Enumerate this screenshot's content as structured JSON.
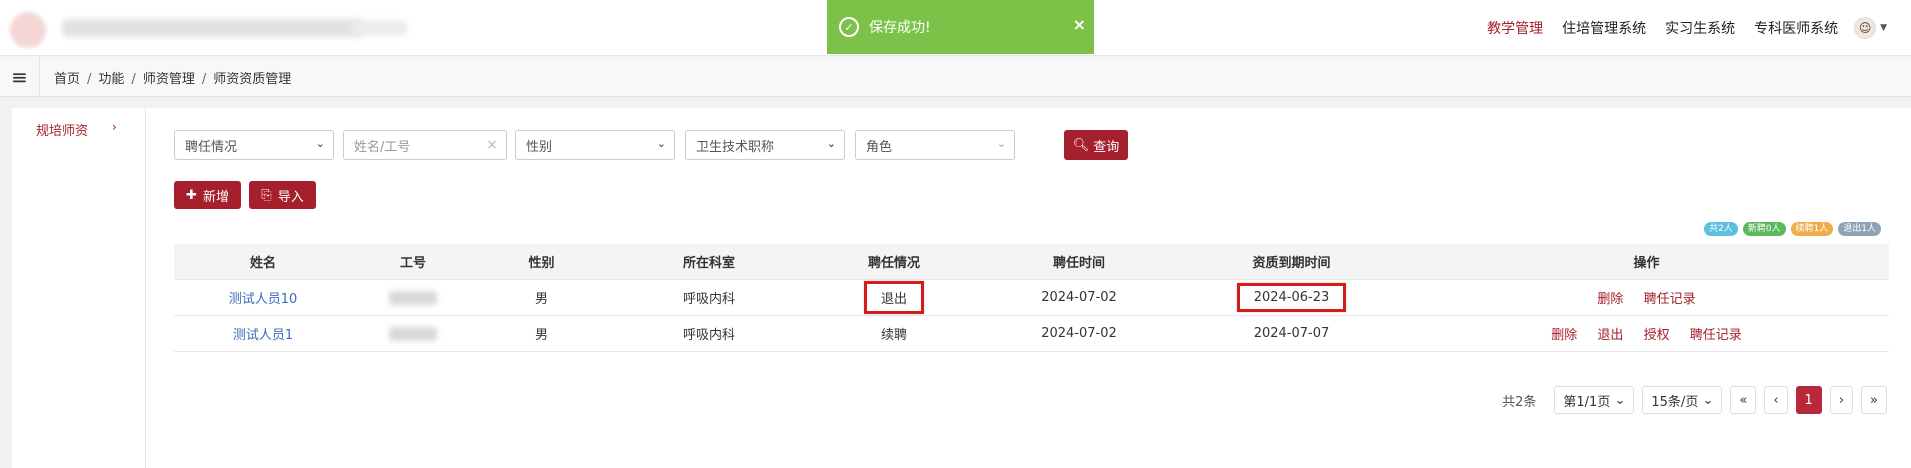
{
  "toast": {
    "message": "保存成功!",
    "close": "×"
  },
  "topnav": [
    {
      "label": "教学管理",
      "active": true
    },
    {
      "label": "住培管理系统",
      "active": false
    },
    {
      "label": "实习生系统",
      "active": false
    },
    {
      "label": "专科医师系统",
      "active": false
    }
  ],
  "breadcrumb": [
    "首页",
    "功能",
    "师资管理",
    "师资资质管理"
  ],
  "sidebar": {
    "item": "规培师资",
    "arrow": "›"
  },
  "filters": {
    "employment": "聘任情况",
    "name_placeholder": "姓名/工号",
    "gender": "性别",
    "title": "卫生技术职称",
    "role": "角色",
    "query": "查询"
  },
  "actions": {
    "add": "新增",
    "import": "导入"
  },
  "badges": [
    {
      "label": "共2人",
      "color": "#5bc0de"
    },
    {
      "label": "新聘0人",
      "color": "#5cb85c"
    },
    {
      "label": "续聘1人",
      "color": "#f0ad4e"
    },
    {
      "label": "退出1人",
      "color": "#8fa3b5"
    }
  ],
  "table": {
    "headers": [
      "姓名",
      "工号",
      "性别",
      "所在科室",
      "聘任情况",
      "聘任时间",
      "资质到期时间",
      "操作"
    ],
    "rows": [
      {
        "name": "测试人员10",
        "gender": "男",
        "dept": "呼吸内科",
        "status": "退出",
        "hire": "2024-07-02",
        "expire": "2024-06-23",
        "ops": [
          "删除",
          "聘任记录"
        ]
      },
      {
        "name": "测试人员1",
        "gender": "男",
        "dept": "呼吸内科",
        "status": "续聘",
        "hire": "2024-07-02",
        "expire": "2024-07-07",
        "ops": [
          "删除",
          "退出",
          "授权",
          "聘任记录"
        ]
      }
    ]
  },
  "pager": {
    "total": "共2条",
    "page": "第1/1页",
    "size": "15条/页",
    "first": "«",
    "prev": "‹",
    "current": "1",
    "next": "›",
    "last": "»"
  }
}
